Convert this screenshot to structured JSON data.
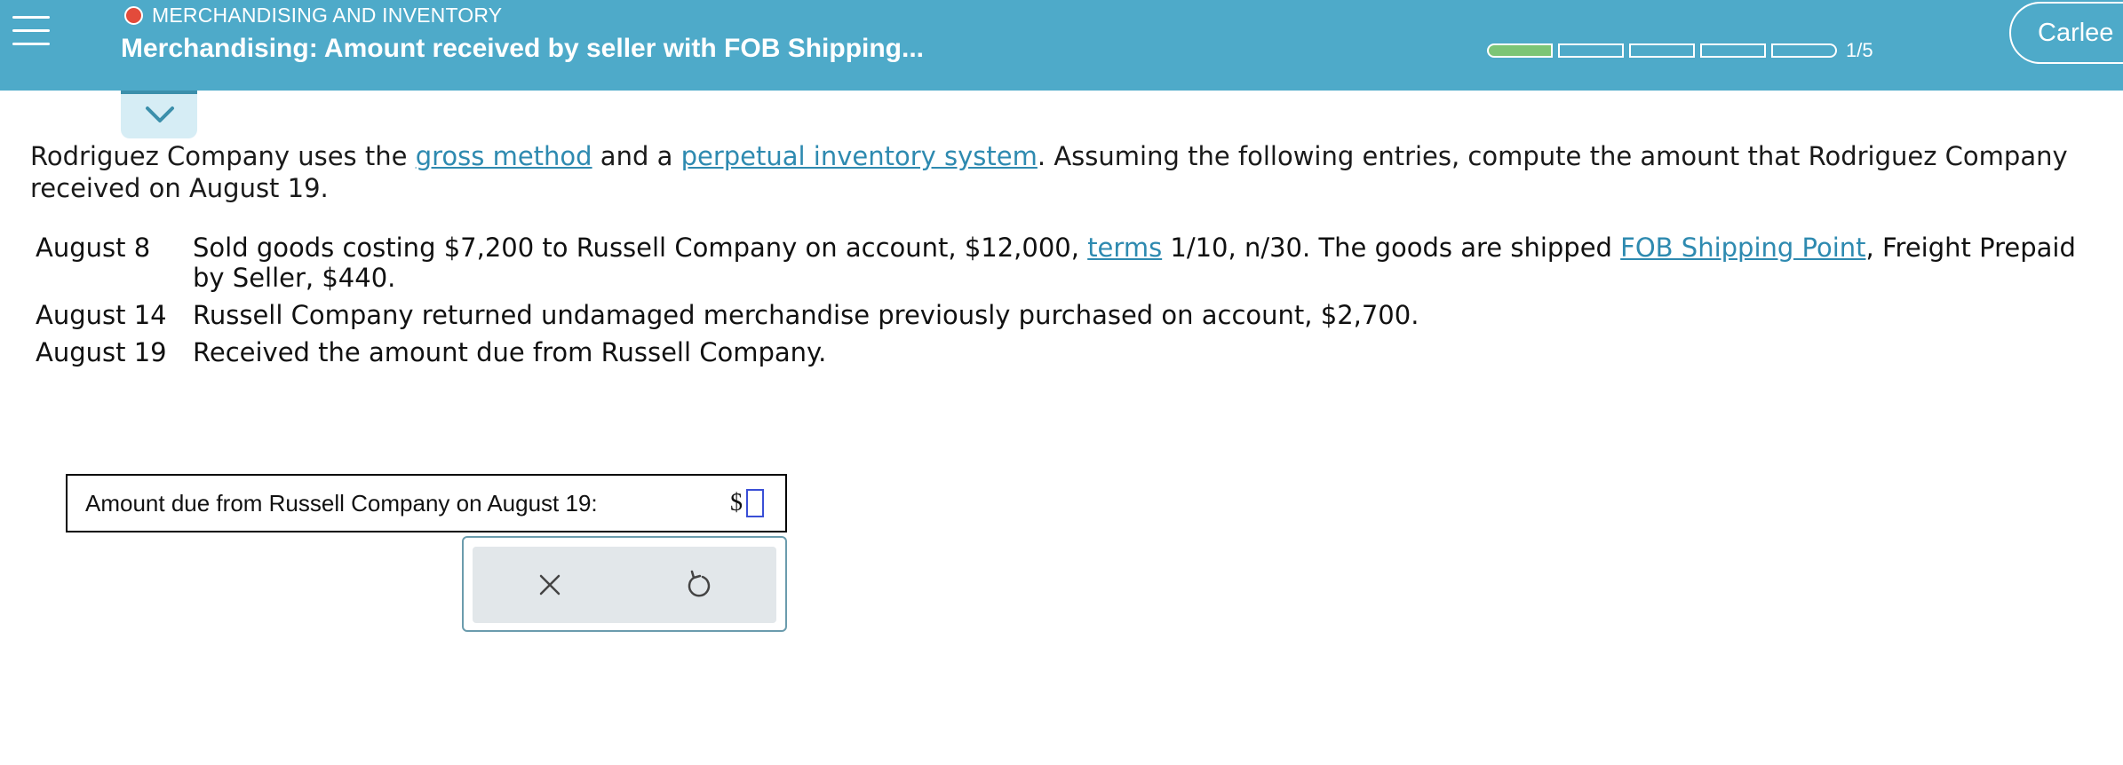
{
  "header": {
    "topic": "MERCHANDISING AND INVENTORY",
    "title": "Merchandising: Amount received by seller with FOB Shipping...",
    "progress_text": "1/5",
    "progress": {
      "current": 1,
      "total": 5
    },
    "user_name": "Carlee",
    "status_color": "#e34b3b",
    "bar_color": "#4eaac9"
  },
  "problem": {
    "intro": {
      "t1": "Rodriguez Company uses the ",
      "link1": "gross method",
      "t2": " and a ",
      "link2": "perpetual inventory system",
      "t3": ". Assuming the following entries, compute the amount that Rodriguez Company received on August 19."
    },
    "entries": [
      {
        "date": "August 8",
        "t1": "Sold goods costing $7,200 to Russell Company on account, $12,000, ",
        "link1": "terms",
        "t2": " 1/10, n/30. The goods are shipped ",
        "link2": "FOB Shipping Point",
        "t3": ", Freight Prepaid by Seller, $440."
      },
      {
        "date": "August 14",
        "text": "Russell Company returned undamaged merchandise previously purchased on account, $2,700."
      },
      {
        "date": "August 19",
        "text": "Received the amount due from Russell Company."
      }
    ]
  },
  "answer": {
    "label": "Amount due from Russell Company on August 19:",
    "currency": "$",
    "value": ""
  },
  "actions": {
    "clear_icon": "close-icon",
    "reset_icon": "undo-icon"
  }
}
